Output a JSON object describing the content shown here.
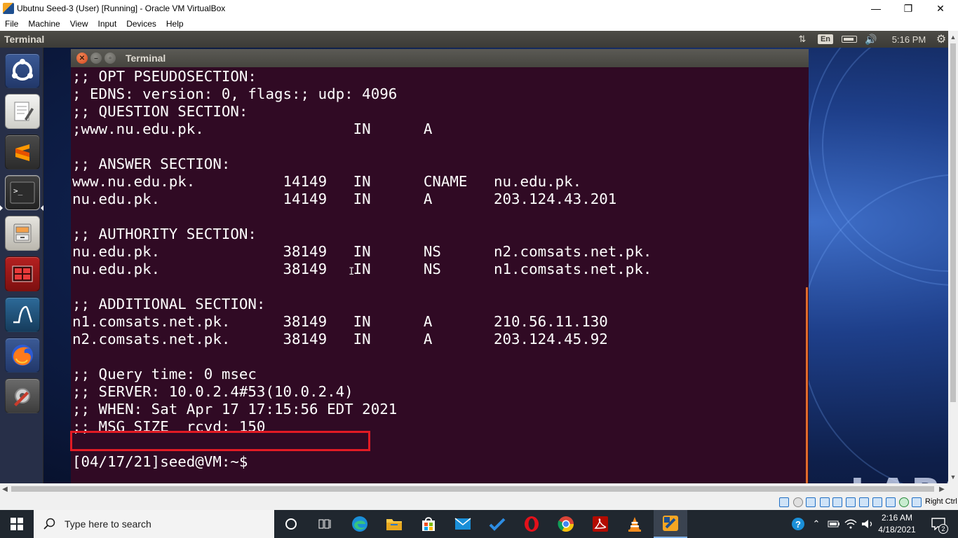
{
  "host_window": {
    "title": "Ubutnu Seed-3 (User) [Running] - Oracle VM VirtualBox",
    "minimize_glyph": "—",
    "maximize_glyph": "❐",
    "close_glyph": "✕",
    "menu": [
      "File",
      "Machine",
      "View",
      "Input",
      "Devices",
      "Help"
    ]
  },
  "guest_panel": {
    "app_name": "Terminal",
    "keyboard_layout": "En",
    "time": "5:16 PM"
  },
  "launcher": {
    "items": [
      "ubuntu-dash",
      "text-editor",
      "sublime-text",
      "terminal",
      "file-manager",
      "remote-desktop",
      "wireshark",
      "firefox",
      "system-settings"
    ],
    "active": "terminal"
  },
  "terminal": {
    "title": "Terminal",
    "lines": [
      ";; OPT PSEUDOSECTION:",
      "; EDNS: version: 0, flags:; udp: 4096",
      ";; QUESTION SECTION:",
      ";www.nu.edu.pk.                 IN      A",
      "",
      ";; ANSWER SECTION:",
      "www.nu.edu.pk.          14149   IN      CNAME   nu.edu.pk.",
      "nu.edu.pk.              14149   IN      A       203.124.43.201",
      "",
      ";; AUTHORITY SECTION:",
      "nu.edu.pk.              38149   IN      NS      n2.comsats.net.pk.",
      "nu.edu.pk.              38149   IN      NS      n1.comsats.net.pk.",
      "",
      ";; ADDITIONAL SECTION:",
      "n1.comsats.net.pk.      38149   IN      A       210.56.11.130",
      "n2.comsats.net.pk.      38149   IN      A       203.124.45.92",
      "",
      ";; Query time: 0 msec",
      ";; SERVER: 10.0.2.4#53(10.0.2.4)",
      ";; WHEN: Sat Apr 17 17:15:56 EDT 2021",
      ";; MSG SIZE  rcvd: 150",
      "",
      "[04/17/21]seed@VM:~$"
    ],
    "highlighted_line": ";; SERVER: 10.0.2.4#53(10.0.2.4)",
    "highlight_color": "#e21b24",
    "background_color": "#300a24"
  },
  "wallpaper_text": "LABS",
  "vbox_status": {
    "host_key": "Right Ctrl"
  },
  "taskbar": {
    "search_placeholder": "Type here to search",
    "apps": [
      "cortana",
      "task-view",
      "edge",
      "file-explorer",
      "microsoft-store",
      "mail",
      "todo",
      "opera",
      "chrome",
      "acrobat",
      "vlc",
      "virtualbox"
    ],
    "active_app": "virtualbox",
    "time": "2:16 AM",
    "date": "4/18/2021",
    "notification_count": "2"
  },
  "colors": {
    "terminal_bg": "#300a24",
    "unity_panel": "#3c3b37",
    "taskbar": "#20272f",
    "accent_orange": "#e06c2c"
  }
}
